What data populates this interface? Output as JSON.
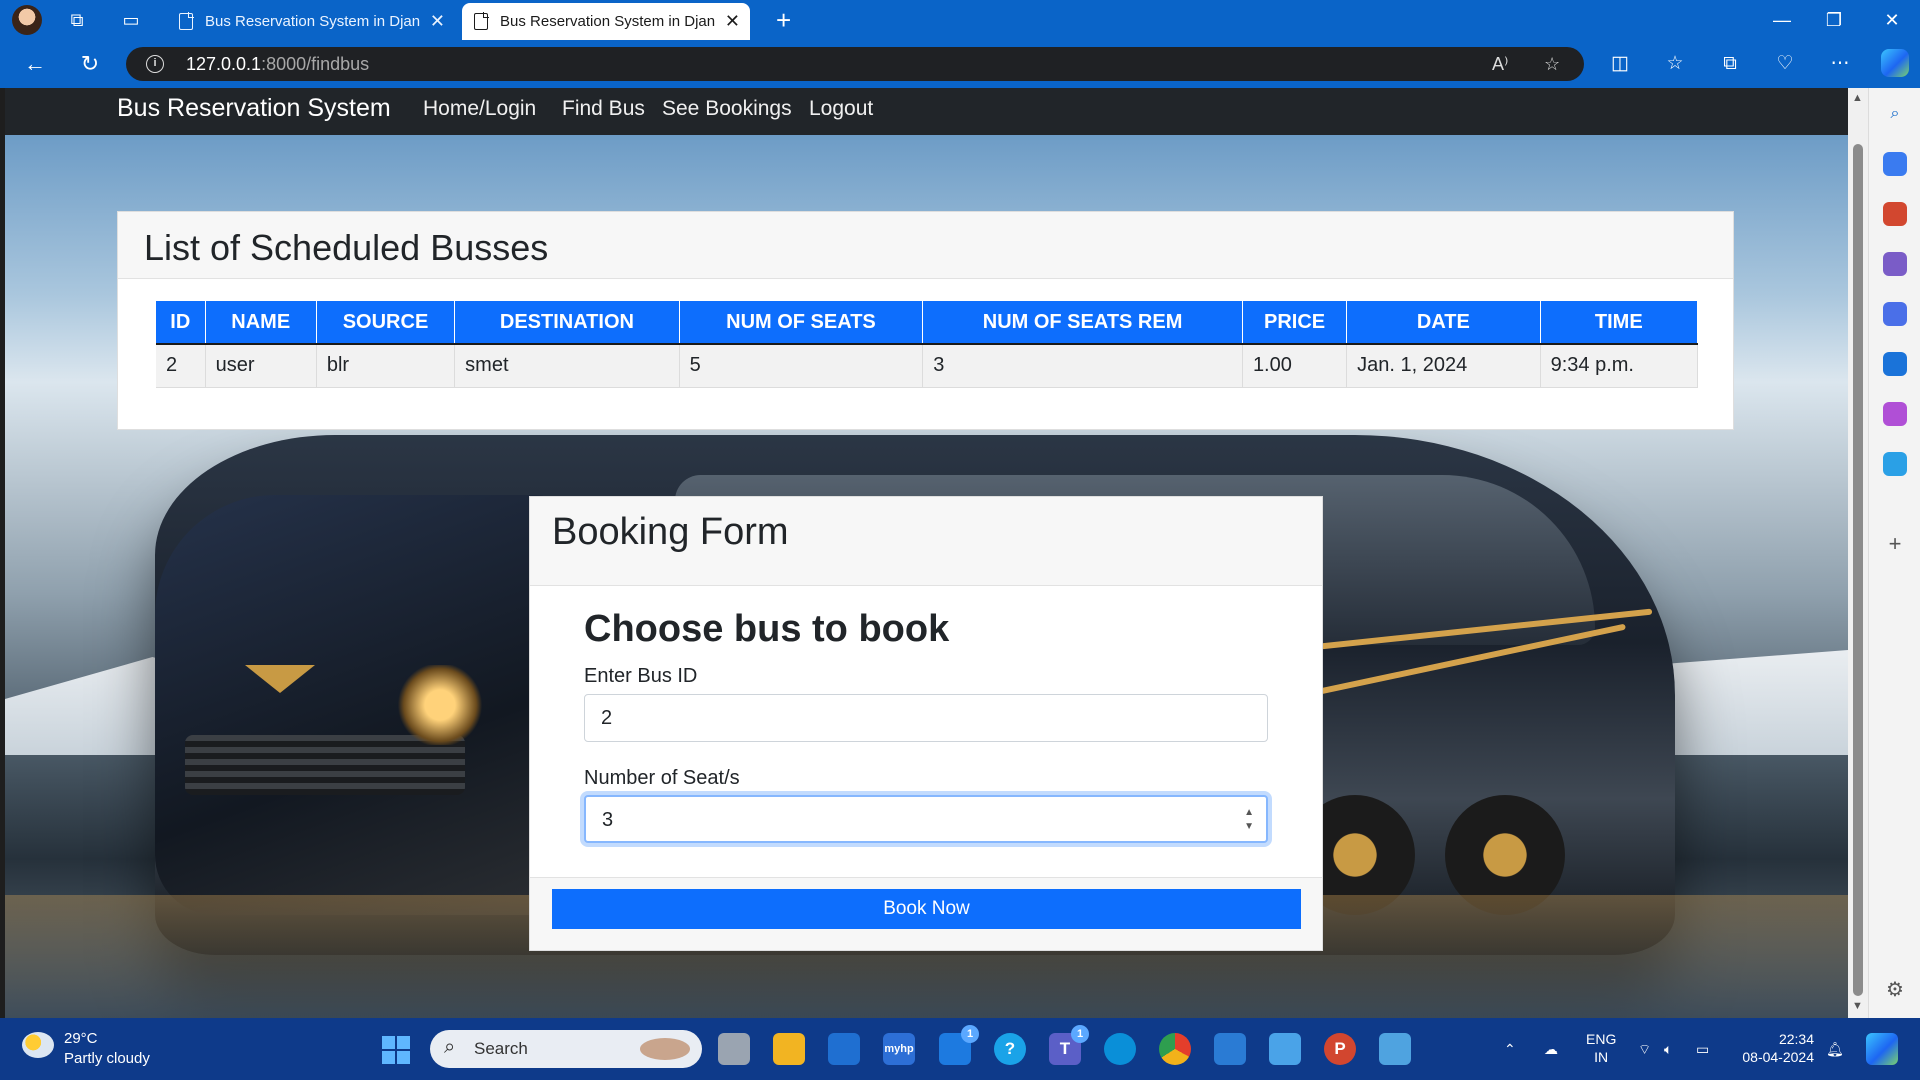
{
  "browser": {
    "tabs": [
      {
        "title": "Bus Reservation System in Django",
        "active": false
      },
      {
        "title": "Bus Reservation System in Django",
        "active": true
      }
    ],
    "url_host": "127.0.0.1",
    "url_path": ":8000/findbus"
  },
  "navbar": {
    "brand": "Bus Reservation System",
    "links": [
      "Home/Login",
      "Find Bus",
      "See Bookings",
      "Logout"
    ]
  },
  "bus_list": {
    "title": "List of Scheduled Busses",
    "columns": [
      "ID",
      "NAME",
      "SOURCE",
      "DESTINATION",
      "NUM OF SEATS",
      "NUM OF SEATS REM",
      "PRICE",
      "DATE",
      "TIME"
    ],
    "rows": [
      [
        "2",
        "user",
        "blr",
        "smet",
        "5",
        "3",
        "1.00",
        "Jan. 1, 2024",
        "9:34 p.m."
      ]
    ]
  },
  "booking_form": {
    "title": "Booking Form",
    "subtitle": "Choose bus to book",
    "bus_id_label": "Enter Bus ID",
    "bus_id_value": "2",
    "seats_label": "Number of Seat/s",
    "seats_value": "3",
    "submit_label": "Book Now"
  },
  "taskbar": {
    "weather_temp": "29°C",
    "weather_desc": "Partly cloudy",
    "search_label": "Search",
    "lang_line1": "ENG",
    "lang_line2": "IN",
    "time": "22:34",
    "date": "08-04-2024",
    "badges": {
      "outlook": "1",
      "teams": "1"
    }
  },
  "colors": {
    "primary": "#0d6efd",
    "navbar": "#212529",
    "browser_frame": "#0a64c8",
    "taskbar": "#0e3a8a"
  }
}
